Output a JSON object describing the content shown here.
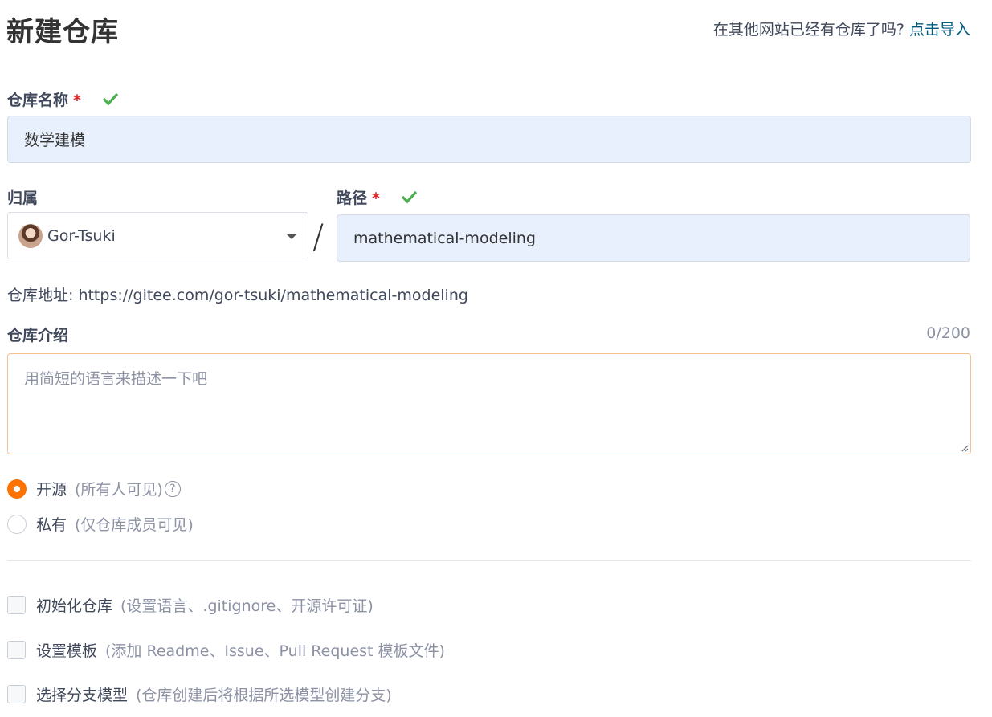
{
  "header": {
    "title": "新建仓库",
    "import_prompt": "在其他网站已经有仓库了吗?",
    "import_link": "点击导入"
  },
  "repo_name": {
    "label": "仓库名称",
    "required_mark": "*",
    "value": "数学建模"
  },
  "owner": {
    "label": "归属",
    "selected": "Gor-Tsuki"
  },
  "separator": "/",
  "path": {
    "label": "路径",
    "required_mark": "*",
    "value": "mathematical-modeling"
  },
  "address": {
    "text": "仓库地址: https://gitee.com/gor-tsuki/mathematical-modeling"
  },
  "description": {
    "label": "仓库介绍",
    "counter": "0/200",
    "placeholder": "用简短的语言来描述一下吧"
  },
  "visibility": {
    "options": [
      {
        "label": "开源",
        "sub": "(所有人可见)",
        "checked": true
      },
      {
        "label": "私有",
        "sub": "(仅仓库成员可见)",
        "checked": false
      }
    ],
    "help_icon": "?"
  },
  "checkboxes": [
    {
      "label": "初始化仓库",
      "sub": "(设置语言、.gitignore、开源许可证)"
    },
    {
      "label": "设置模板",
      "sub": "(添加 Readme、Issue、Pull Request 模板文件)"
    },
    {
      "label": "选择分支模型",
      "sub": "(仓库创建后将根据所选模型创建分支)"
    }
  ],
  "colors": {
    "accent": "#fe7300",
    "link": "#005980",
    "valid_check": "#4caf50",
    "required": "#e02424",
    "autofill_bg": "#e8f0fe"
  }
}
